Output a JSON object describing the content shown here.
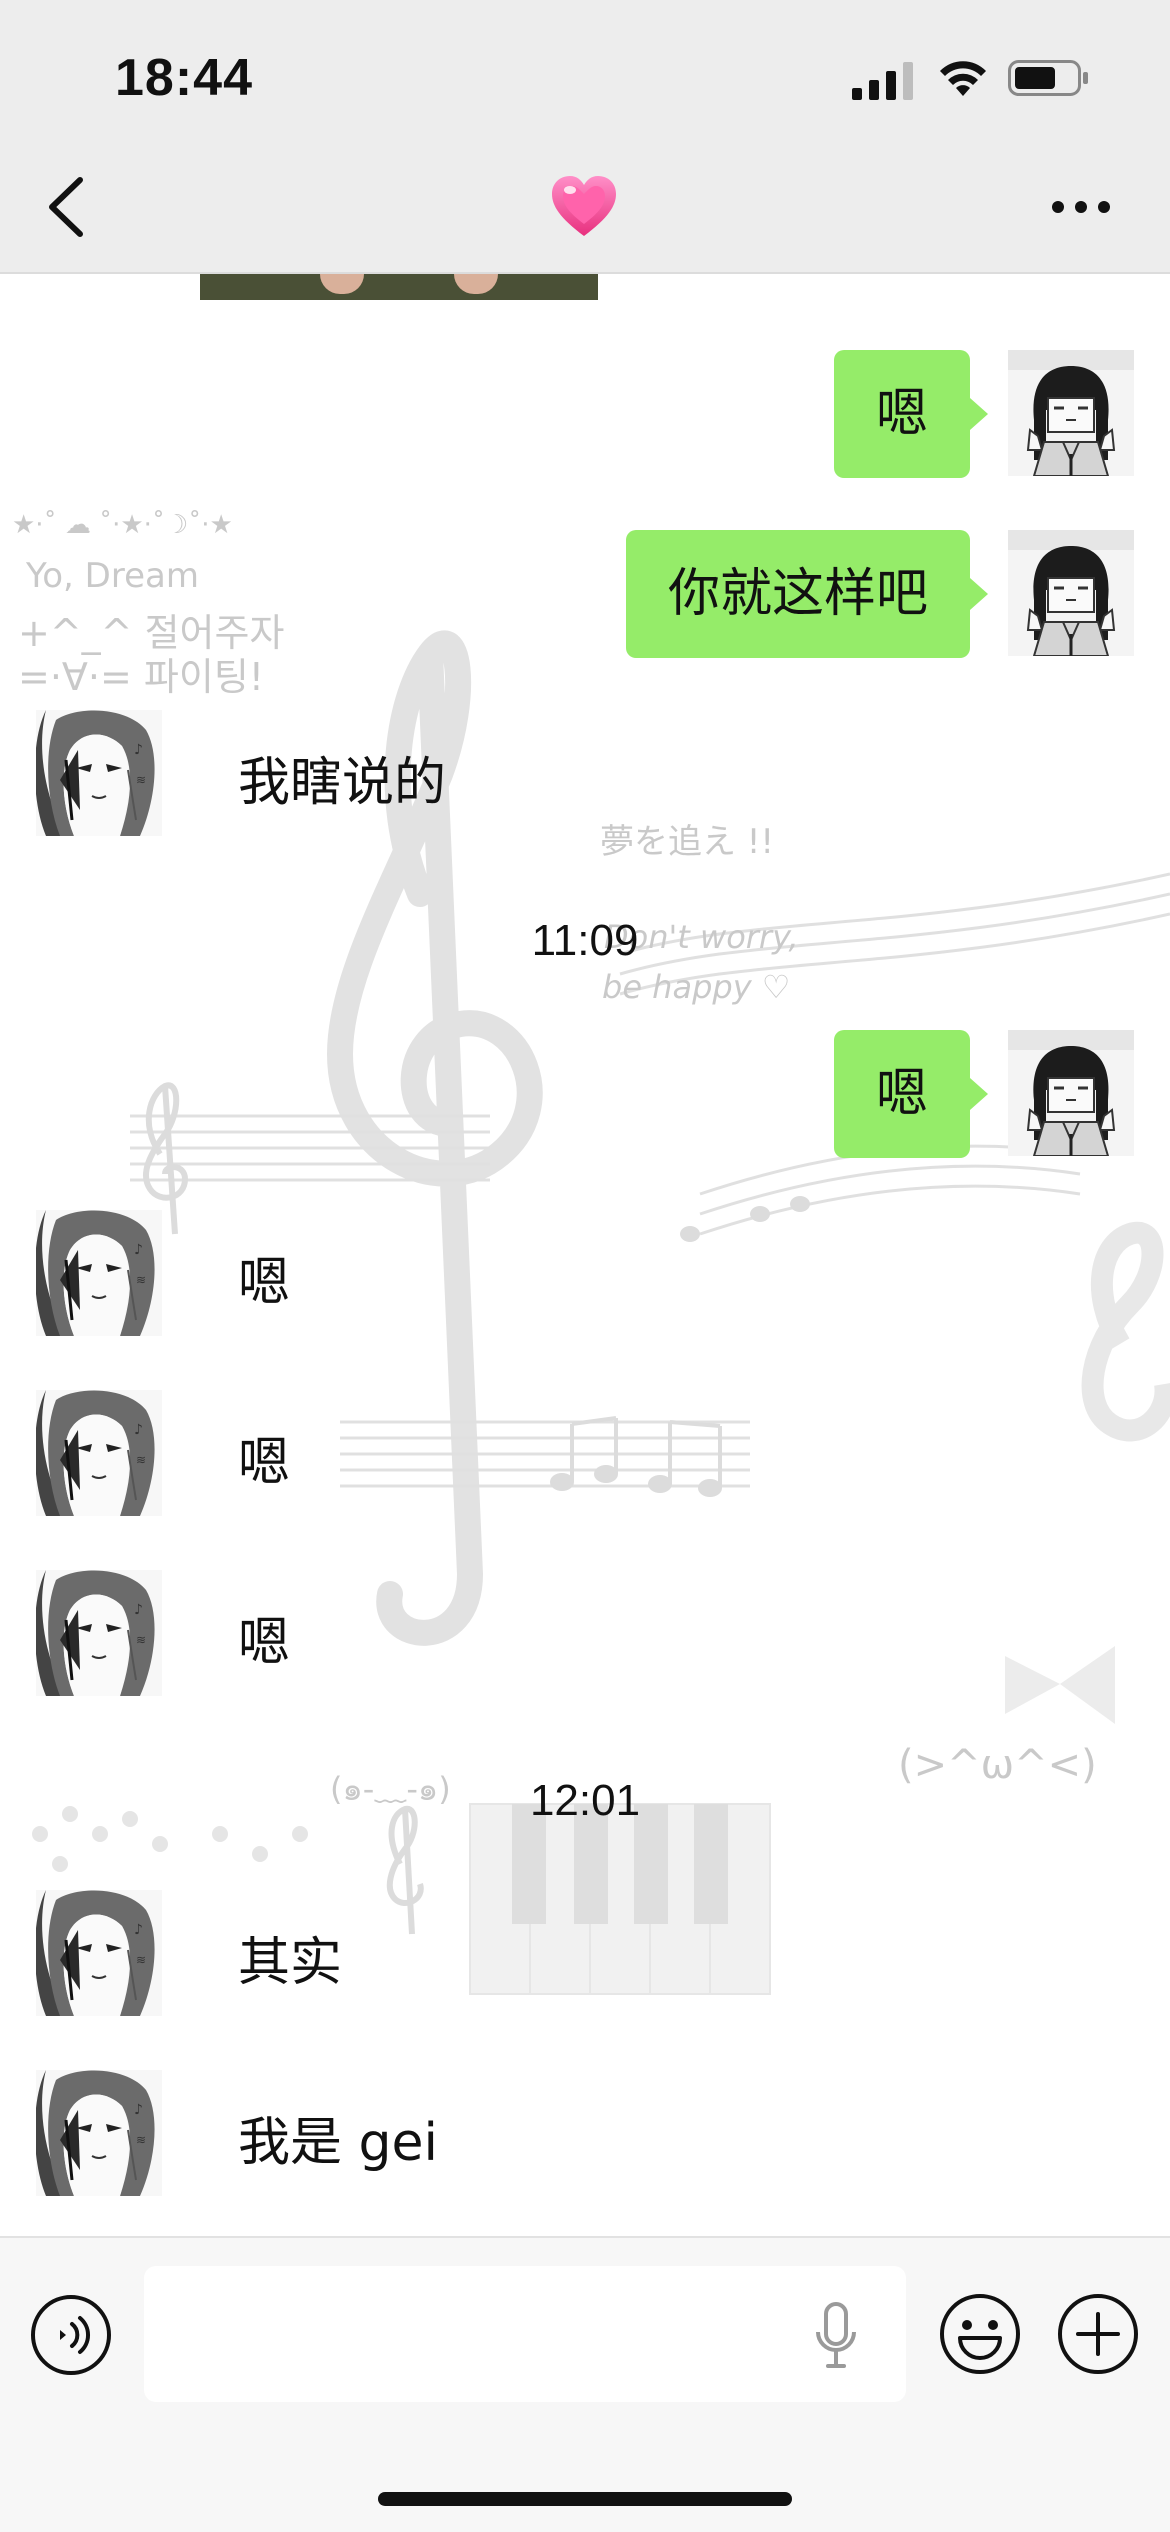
{
  "status_bar": {
    "time": "18:44"
  },
  "nav": {
    "title_icon": "heart-emoji",
    "back_icon": "chevron-left-icon",
    "more_icon": "ellipsis-icon"
  },
  "messages": [
    {
      "side": "mine",
      "text": "嗯"
    },
    {
      "side": "mine",
      "text": "你就这样吧"
    },
    {
      "side": "theirs",
      "text": "我瞎说的"
    },
    {
      "type": "timestamp",
      "text": "11:09"
    },
    {
      "side": "mine",
      "text": "嗯"
    },
    {
      "side": "theirs",
      "text": "嗯"
    },
    {
      "side": "theirs",
      "text": "嗯"
    },
    {
      "side": "theirs",
      "text": "嗯"
    },
    {
      "type": "timestamp",
      "text": "12:01"
    },
    {
      "side": "theirs",
      "text": "其实"
    },
    {
      "side": "theirs",
      "text": "我是 gei"
    }
  ],
  "background_decor": {
    "line1": "★·˚ ☁ ˚·★·˚☽˚·★",
    "line2": "Yo, Dream",
    "line3": "+^_^ 절어주자",
    "line4": "=·∀·= 파이팅!",
    "line5": "夢を追え !!",
    "line6": "Don't worry,",
    "line7": "be happy ♡",
    "line8": "(>^ω^<)",
    "line9": "(๑-﹏-๑)"
  },
  "input": {
    "value": "",
    "placeholder": ""
  },
  "colors": {
    "bubble_mine": "#95ec69",
    "background": "#ededed",
    "chat_bg": "#ffffff"
  }
}
